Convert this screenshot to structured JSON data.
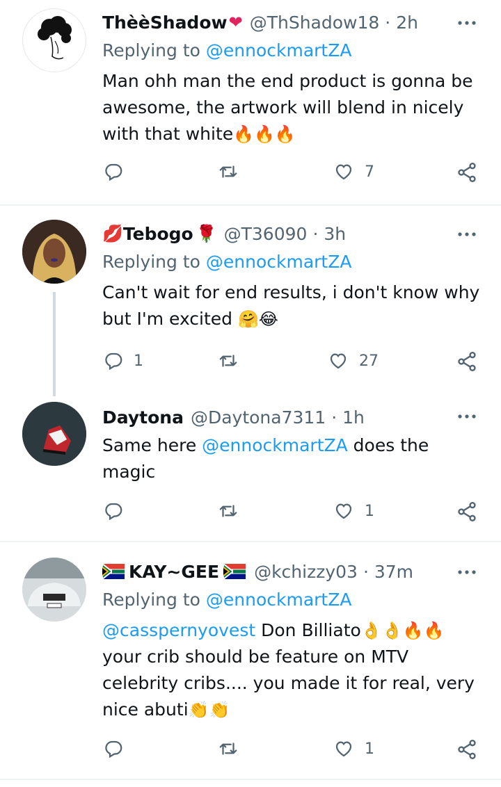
{
  "tweets": [
    {
      "name": "ThèèShadow",
      "name_suffix": "❤",
      "handle": "@ThShadow18",
      "time": "· 2h",
      "replying_prefix": "Replying to ",
      "replying_to": "@ennockmartZA",
      "text": "Man ohh man the end product is gonna be awesome, the artwork will blend in nicely with that white",
      "emoji": "🔥🔥🔥",
      "reply_count": "",
      "retweet_count": "",
      "like_count": "7"
    },
    {
      "name_prefix": "💋",
      "name": "Tebogo",
      "name_suffix": "🌹",
      "handle": "@T36090",
      "time": "· 3h",
      "replying_prefix": "Replying to ",
      "replying_to": "@ennockmartZA",
      "text": "Can't wait for end results, i don't know why but I'm excited ",
      "emoji": "🤗😂",
      "reply_count": "1",
      "retweet_count": "",
      "like_count": "27"
    },
    {
      "name": "Daytona",
      "handle": "@Daytona7311",
      "time": "· 1h",
      "text_before": "Same here ",
      "mention": "@ennockmartZA",
      "text_after": " does the magic",
      "reply_count": "",
      "retweet_count": "",
      "like_count": "1"
    },
    {
      "name": "KAY~GEE",
      "handle": "@kchizzy03",
      "time": "· 37m",
      "replying_prefix": "Replying to ",
      "replying_to": "@ennockmartZA",
      "mention": "@casspernyovest",
      "text_a": " Don Billiato",
      "emoji_a": "👌👌🔥🔥",
      "text_b": " your crib should be feature on MTV celebrity cribs.... you made it for real, very nice abuti",
      "emoji_b": "👏👏",
      "reply_count": "",
      "retweet_count": "",
      "like_count": "1"
    }
  ],
  "colors": {
    "text": "#0f1419",
    "secondary": "#536471",
    "link": "#1d9bf0",
    "divider": "#eff3f4",
    "thread_line": "#cfd9de"
  }
}
